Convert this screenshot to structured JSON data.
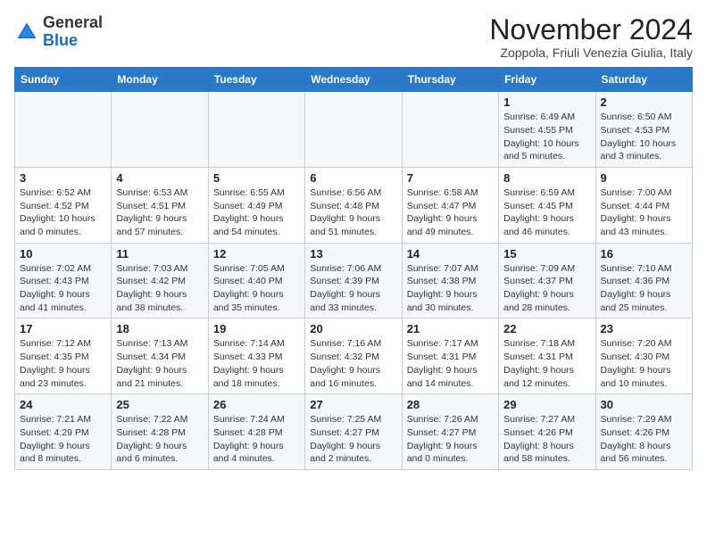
{
  "logo": {
    "general": "General",
    "blue": "Blue"
  },
  "title": "November 2024",
  "location": "Zoppola, Friuli Venezia Giulia, Italy",
  "weekdays": [
    "Sunday",
    "Monday",
    "Tuesday",
    "Wednesday",
    "Thursday",
    "Friday",
    "Saturday"
  ],
  "weeks": [
    [
      {
        "day": "",
        "info": ""
      },
      {
        "day": "",
        "info": ""
      },
      {
        "day": "",
        "info": ""
      },
      {
        "day": "",
        "info": ""
      },
      {
        "day": "",
        "info": ""
      },
      {
        "day": "1",
        "info": "Sunrise: 6:49 AM\nSunset: 4:55 PM\nDaylight: 10 hours and 5 minutes."
      },
      {
        "day": "2",
        "info": "Sunrise: 6:50 AM\nSunset: 4:53 PM\nDaylight: 10 hours and 3 minutes."
      }
    ],
    [
      {
        "day": "3",
        "info": "Sunrise: 6:52 AM\nSunset: 4:52 PM\nDaylight: 10 hours and 0 minutes."
      },
      {
        "day": "4",
        "info": "Sunrise: 6:53 AM\nSunset: 4:51 PM\nDaylight: 9 hours and 57 minutes."
      },
      {
        "day": "5",
        "info": "Sunrise: 6:55 AM\nSunset: 4:49 PM\nDaylight: 9 hours and 54 minutes."
      },
      {
        "day": "6",
        "info": "Sunrise: 6:56 AM\nSunset: 4:48 PM\nDaylight: 9 hours and 51 minutes."
      },
      {
        "day": "7",
        "info": "Sunrise: 6:58 AM\nSunset: 4:47 PM\nDaylight: 9 hours and 49 minutes."
      },
      {
        "day": "8",
        "info": "Sunrise: 6:59 AM\nSunset: 4:45 PM\nDaylight: 9 hours and 46 minutes."
      },
      {
        "day": "9",
        "info": "Sunrise: 7:00 AM\nSunset: 4:44 PM\nDaylight: 9 hours and 43 minutes."
      }
    ],
    [
      {
        "day": "10",
        "info": "Sunrise: 7:02 AM\nSunset: 4:43 PM\nDaylight: 9 hours and 41 minutes."
      },
      {
        "day": "11",
        "info": "Sunrise: 7:03 AM\nSunset: 4:42 PM\nDaylight: 9 hours and 38 minutes."
      },
      {
        "day": "12",
        "info": "Sunrise: 7:05 AM\nSunset: 4:40 PM\nDaylight: 9 hours and 35 minutes."
      },
      {
        "day": "13",
        "info": "Sunrise: 7:06 AM\nSunset: 4:39 PM\nDaylight: 9 hours and 33 minutes."
      },
      {
        "day": "14",
        "info": "Sunrise: 7:07 AM\nSunset: 4:38 PM\nDaylight: 9 hours and 30 minutes."
      },
      {
        "day": "15",
        "info": "Sunrise: 7:09 AM\nSunset: 4:37 PM\nDaylight: 9 hours and 28 minutes."
      },
      {
        "day": "16",
        "info": "Sunrise: 7:10 AM\nSunset: 4:36 PM\nDaylight: 9 hours and 25 minutes."
      }
    ],
    [
      {
        "day": "17",
        "info": "Sunrise: 7:12 AM\nSunset: 4:35 PM\nDaylight: 9 hours and 23 minutes."
      },
      {
        "day": "18",
        "info": "Sunrise: 7:13 AM\nSunset: 4:34 PM\nDaylight: 9 hours and 21 minutes."
      },
      {
        "day": "19",
        "info": "Sunrise: 7:14 AM\nSunset: 4:33 PM\nDaylight: 9 hours and 18 minutes."
      },
      {
        "day": "20",
        "info": "Sunrise: 7:16 AM\nSunset: 4:32 PM\nDaylight: 9 hours and 16 minutes."
      },
      {
        "day": "21",
        "info": "Sunrise: 7:17 AM\nSunset: 4:31 PM\nDaylight: 9 hours and 14 minutes."
      },
      {
        "day": "22",
        "info": "Sunrise: 7:18 AM\nSunset: 4:31 PM\nDaylight: 9 hours and 12 minutes."
      },
      {
        "day": "23",
        "info": "Sunrise: 7:20 AM\nSunset: 4:30 PM\nDaylight: 9 hours and 10 minutes."
      }
    ],
    [
      {
        "day": "24",
        "info": "Sunrise: 7:21 AM\nSunset: 4:29 PM\nDaylight: 9 hours and 8 minutes."
      },
      {
        "day": "25",
        "info": "Sunrise: 7:22 AM\nSunset: 4:28 PM\nDaylight: 9 hours and 6 minutes."
      },
      {
        "day": "26",
        "info": "Sunrise: 7:24 AM\nSunset: 4:28 PM\nDaylight: 9 hours and 4 minutes."
      },
      {
        "day": "27",
        "info": "Sunrise: 7:25 AM\nSunset: 4:27 PM\nDaylight: 9 hours and 2 minutes."
      },
      {
        "day": "28",
        "info": "Sunrise: 7:26 AM\nSunset: 4:27 PM\nDaylight: 9 hours and 0 minutes."
      },
      {
        "day": "29",
        "info": "Sunrise: 7:27 AM\nSunset: 4:26 PM\nDaylight: 8 hours and 58 minutes."
      },
      {
        "day": "30",
        "info": "Sunrise: 7:29 AM\nSunset: 4:26 PM\nDaylight: 8 hours and 56 minutes."
      }
    ]
  ]
}
